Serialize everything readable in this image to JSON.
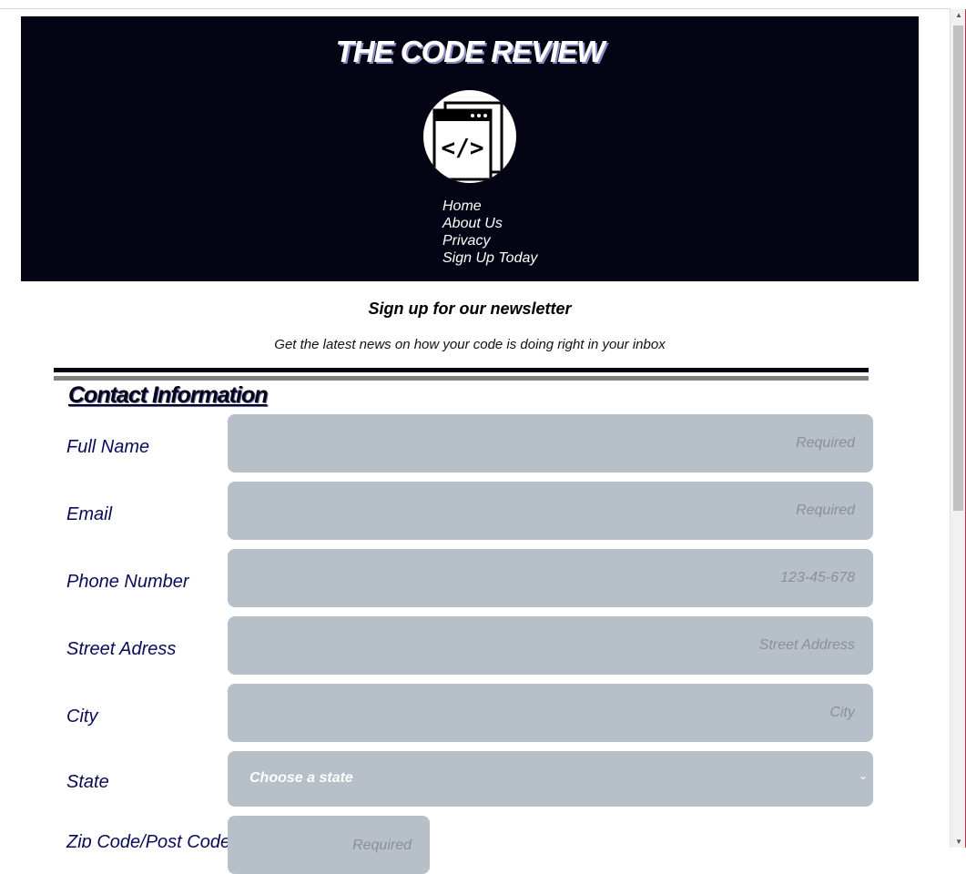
{
  "header": {
    "site_title": "THE CODE REVIEW",
    "logo_icon": "code-window-icon",
    "nav": [
      "Home",
      "About Us",
      "Privacy",
      "Sign Up Today"
    ]
  },
  "newsletter": {
    "title": "Sign up for our newsletter",
    "subtitle": "Get the latest news on how your code is doing right in your inbox"
  },
  "contact": {
    "section_title": "Contact Information",
    "fields": [
      {
        "label": "Full Name",
        "placeholder": "Required"
      },
      {
        "label": "Email",
        "placeholder": "Required"
      },
      {
        "label": "Phone Number",
        "placeholder": "123-45-678"
      },
      {
        "label": "Street Adress",
        "placeholder": "Street Address"
      },
      {
        "label": "City",
        "placeholder": "City"
      }
    ],
    "state": {
      "label": "State",
      "selected": "Choose a state"
    },
    "zip": {
      "label": "Zip Code/Post Code",
      "placeholder": "Required"
    }
  },
  "colors": {
    "header_bg": "#040414",
    "input_bg": "#b7c0c8",
    "label_color": "#0a0a5a"
  }
}
